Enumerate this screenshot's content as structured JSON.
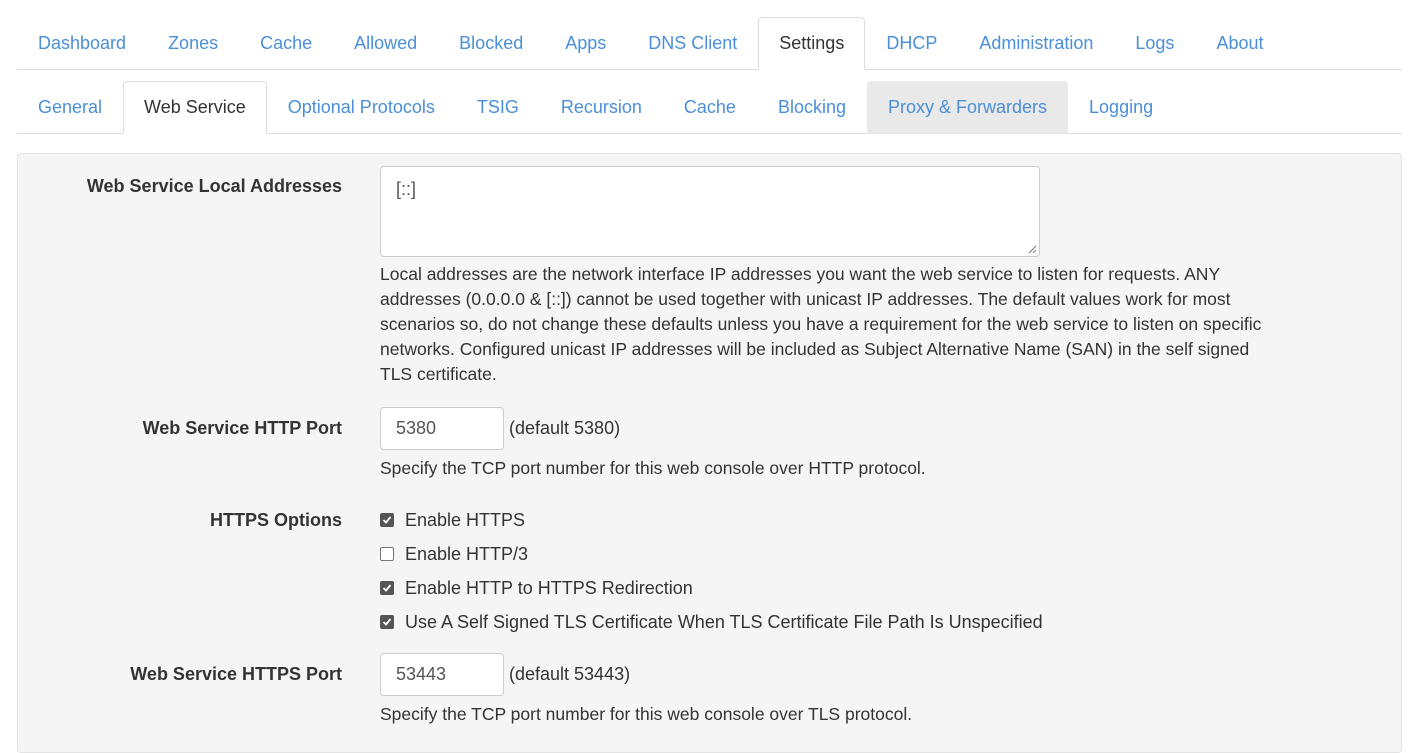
{
  "main_tabs": [
    {
      "label": "Dashboard"
    },
    {
      "label": "Zones"
    },
    {
      "label": "Cache"
    },
    {
      "label": "Allowed"
    },
    {
      "label": "Blocked"
    },
    {
      "label": "Apps"
    },
    {
      "label": "DNS Client"
    },
    {
      "label": "Settings",
      "active": true
    },
    {
      "label": "DHCP"
    },
    {
      "label": "Administration"
    },
    {
      "label": "Logs"
    },
    {
      "label": "About"
    }
  ],
  "settings_tabs": [
    {
      "label": "General"
    },
    {
      "label": "Web Service",
      "active": true
    },
    {
      "label": "Optional Protocols"
    },
    {
      "label": "TSIG"
    },
    {
      "label": "Recursion"
    },
    {
      "label": "Cache"
    },
    {
      "label": "Blocking"
    },
    {
      "label": "Proxy & Forwarders",
      "hovered": true
    },
    {
      "label": "Logging"
    }
  ],
  "form": {
    "local_addresses": {
      "label": "Web Service Local Addresses",
      "value": "[::]",
      "help": "Local addresses are the network interface IP addresses you want the web service to listen for requests. ANY addresses (0.0.0.0 & [::]) cannot be used together with unicast IP addresses. The default values work for most scenarios so, do not change these defaults unless you have a requirement for the web service to listen on specific networks. Configured unicast IP addresses will be included as Subject Alternative Name (SAN) in the self signed TLS certificate."
    },
    "http_port": {
      "label": "Web Service HTTP Port",
      "value": "5380",
      "default_note": "(default 5380)",
      "help": "Specify the TCP port number for this web console over HTTP protocol."
    },
    "https_options": {
      "label": "HTTPS Options",
      "options": [
        {
          "label": "Enable HTTPS",
          "checked": true
        },
        {
          "label": "Enable HTTP/3",
          "checked": false
        },
        {
          "label": "Enable HTTP to HTTPS Redirection",
          "checked": true
        },
        {
          "label": "Use A Self Signed TLS Certificate When TLS Certificate File Path Is Unspecified",
          "checked": true
        }
      ]
    },
    "https_port": {
      "label": "Web Service HTTPS Port",
      "value": "53443",
      "default_note": "(default 53443)",
      "help": "Specify the TCP port number for this web console over TLS protocol."
    }
  },
  "colors": {
    "link": "#4a8fd8",
    "text": "#333333",
    "panel_bg": "#f5f5f5",
    "tab_hover_bg": "#e9e9e9",
    "border": "#dddddd"
  }
}
